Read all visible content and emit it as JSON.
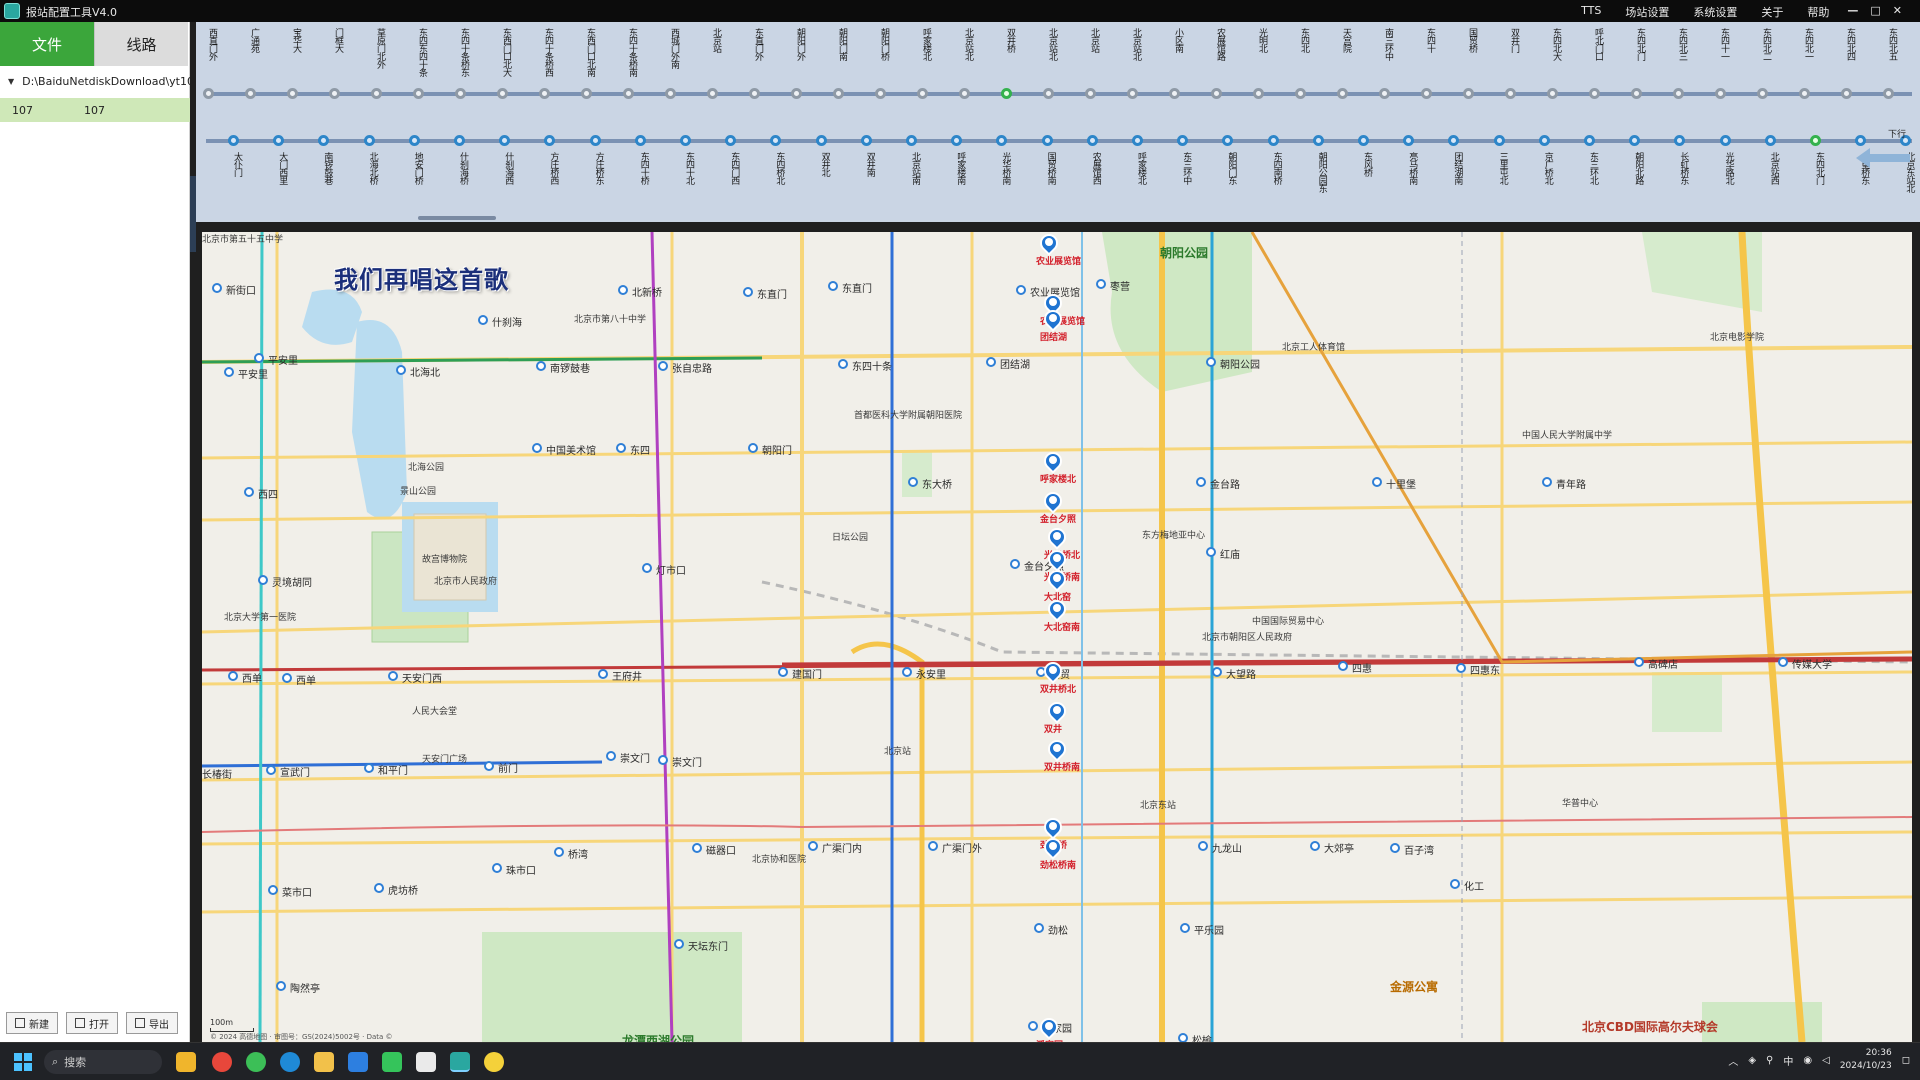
{
  "window": {
    "title": "报站配置工具V4.0",
    "menu": [
      "TTS",
      "场站设置",
      "系统设置",
      "关于",
      "帮助"
    ],
    "controls": [
      "—",
      "□",
      "✕"
    ]
  },
  "left_panel": {
    "tabs": {
      "file": "文件",
      "route": "线路"
    },
    "tree_path": "D:\\BaiduNetdiskDownload\\yt10",
    "route_row": {
      "col1": "107",
      "col2": "107"
    },
    "buttons": {
      "new": "新建",
      "open": "打开",
      "export": "导出"
    }
  },
  "diagram": {
    "down_label": "下行",
    "up_stations": [
      "西直门外",
      "广通苑",
      "宝华大",
      "门框大",
      "草原门北外",
      "东四东四十条",
      "东四十条桥东",
      "东西门口北大",
      "东四十条桥西",
      "东西门口北南",
      "东四十条桥南",
      "西城门外南",
      "北京站",
      "东直门外",
      "朝阳门外",
      "朝阳门南",
      "朝阳门桥",
      "呼家楼北",
      "北京站北",
      "双井桥",
      "北京站北",
      "北京站",
      "北京站北",
      "小区南",
      "农展馆路",
      "光明北",
      "东四北",
      "天宫院",
      "南三环中",
      "东四十",
      "国贸桥",
      "双井门",
      "东四北大",
      "呼北门口",
      "东四北门",
      "东四北三",
      "东四十一",
      "东四北二",
      "东四北一",
      "东四北四",
      "东四北五"
    ],
    "down_stations": [
      "太仆门",
      "大门西里",
      "南锣鼓巷",
      "北海北桥",
      "地安门桥",
      "什刹海桥",
      "什刹海西",
      "方庄桥西",
      "方庄桥东",
      "东四十桥",
      "东四十北",
      "东四门西",
      "东四桥北",
      "双井北",
      "双井南",
      "北京站南",
      "呼家楼南",
      "光华桥南",
      "国贸桥南",
      "农展馆西",
      "呼家楼北",
      "东三环中",
      "朝阳门东",
      "东四南桥",
      "朝阳公园东",
      "东风桥",
      "亮马桥南",
      "团结湖南",
      "三里屯北",
      "京广桥北",
      "东三环北",
      "朝阳北路",
      "长虹桥东",
      "光华路北",
      "北京站西",
      "东四北门",
      "大望桥东",
      "北京东站北"
    ],
    "active_up_index": 19,
    "active_down_index": 35
  },
  "map": {
    "overlay_lyric": "我们再唱这首歌",
    "labels": [
      {
        "t": "新街口",
        "c": "m"
      },
      {
        "t": "北新桥",
        "c": "m"
      },
      {
        "t": "东直门",
        "c": "m"
      },
      {
        "t": "东直门",
        "c": "m"
      },
      {
        "t": "农业展览馆",
        "c": "m"
      },
      {
        "t": "枣营",
        "c": "m"
      },
      {
        "t": "朝阳公园",
        "c": "big"
      },
      {
        "t": "什刹海",
        "c": "m"
      },
      {
        "t": "平安里",
        "c": "m"
      },
      {
        "t": "平安里",
        "c": "m"
      },
      {
        "t": "北海北",
        "c": "m"
      },
      {
        "t": "南锣鼓巷",
        "c": "m"
      },
      {
        "t": "张自忠路",
        "c": "m"
      },
      {
        "t": "东四十条",
        "c": "m"
      },
      {
        "t": "团结湖",
        "c": "m"
      },
      {
        "t": "朝阳公园",
        "c": "m"
      },
      {
        "t": "中国美术馆",
        "c": "m"
      },
      {
        "t": "东四",
        "c": "m"
      },
      {
        "t": "朝阳门",
        "c": "m"
      },
      {
        "t": "东大桥",
        "c": "m"
      },
      {
        "t": "金台路",
        "c": "m"
      },
      {
        "t": "十里堡",
        "c": "m"
      },
      {
        "t": "青年路",
        "c": "m"
      },
      {
        "t": "西四",
        "c": "m"
      },
      {
        "t": "灯市口",
        "c": "m"
      },
      {
        "t": "金台夕照",
        "c": "m"
      },
      {
        "t": "红庙",
        "c": "m"
      },
      {
        "t": "灵境胡同",
        "c": "m"
      },
      {
        "t": "西单",
        "c": "m"
      },
      {
        "t": "西单",
        "c": "m"
      },
      {
        "t": "天安门西",
        "c": "m"
      },
      {
        "t": "王府井",
        "c": "m"
      },
      {
        "t": "建国门",
        "c": "m"
      },
      {
        "t": "永安里",
        "c": "m"
      },
      {
        "t": "国贸",
        "c": "m"
      },
      {
        "t": "大望路",
        "c": "m"
      },
      {
        "t": "四惠",
        "c": "m"
      },
      {
        "t": "四惠东",
        "c": "m"
      },
      {
        "t": "高碑店",
        "c": "m"
      },
      {
        "t": "传媒大学",
        "c": "m"
      },
      {
        "t": "长椿街",
        "c": "m"
      },
      {
        "t": "宣武门",
        "c": "m"
      },
      {
        "t": "和平门",
        "c": "m"
      },
      {
        "t": "前门",
        "c": "m"
      },
      {
        "t": "崇文门",
        "c": "m"
      },
      {
        "t": "崇文门",
        "c": "m"
      },
      {
        "t": "磁器口",
        "c": "m"
      },
      {
        "t": "广渠门内",
        "c": "m"
      },
      {
        "t": "广渠门外",
        "c": "m"
      },
      {
        "t": "九龙山",
        "c": "m"
      },
      {
        "t": "大郊亭",
        "c": "m"
      },
      {
        "t": "百子湾",
        "c": "m"
      },
      {
        "t": "化工",
        "c": "m"
      },
      {
        "t": "菜市口",
        "c": "m"
      },
      {
        "t": "虎坊桥",
        "c": "m"
      },
      {
        "t": "珠市口",
        "c": "m"
      },
      {
        "t": "桥湾",
        "c": "m"
      },
      {
        "t": "天坛东门",
        "c": "m"
      },
      {
        "t": "劲松",
        "c": "m"
      },
      {
        "t": "平乐园",
        "c": "m"
      },
      {
        "t": "陶然亭",
        "c": "m"
      },
      {
        "t": "潘家园",
        "c": "m"
      },
      {
        "t": "松榆",
        "c": "m"
      },
      {
        "t": "金源公寓",
        "c": "orange"
      },
      {
        "t": "北京CBD国际高尔夫球会",
        "c": "red"
      },
      {
        "t": "龙潭西湖公园",
        "c": "big"
      },
      {
        "t": "故宫博物院",
        "c": ""
      },
      {
        "t": "北京站",
        "c": ""
      },
      {
        "t": "北京东站",
        "c": ""
      },
      {
        "t": "日坛公园",
        "c": ""
      },
      {
        "t": "中国国际贸易中心",
        "c": ""
      },
      {
        "t": "北京协和医院",
        "c": ""
      },
      {
        "t": "北京大学第一医院",
        "c": ""
      },
      {
        "t": "北海公园",
        "c": ""
      },
      {
        "t": "景山公园",
        "c": ""
      },
      {
        "t": "人民大会堂",
        "c": ""
      },
      {
        "t": "天安门广场",
        "c": ""
      },
      {
        "t": "北京市人民政府",
        "c": ""
      },
      {
        "t": "中国人民大学附属中学",
        "c": ""
      },
      {
        "t": "北京工人体育馆",
        "c": ""
      },
      {
        "t": "东方梅地亚中心",
        "c": ""
      },
      {
        "t": "首都医科大学附属朝阳医院",
        "c": ""
      },
      {
        "t": "北京市朝阳区人民政府",
        "c": ""
      },
      {
        "t": "华普中心",
        "c": ""
      },
      {
        "t": "北京电影学院",
        "c": ""
      },
      {
        "t": "北京市第八十中学",
        "c": ""
      },
      {
        "t": "北京市第五十五中学",
        "c": ""
      }
    ],
    "pins": [
      "农业展览馆",
      "农业展览馆",
      "团结湖",
      "呼家楼北",
      "金台夕照",
      "光华桥北",
      "光华桥南",
      "大北窑",
      "大北窑南",
      "双井桥北",
      "双井",
      "双井桥南",
      "劲松桥",
      "劲松桥南",
      "潘家园"
    ],
    "scale": "100m",
    "copyright": "© 2024 高德地图 · 审图号：GS(2024)5002号 · Data ©"
  },
  "taskbar": {
    "search_placeholder": "搜索",
    "tray": {
      "ime": "中",
      "time": "20:36",
      "date": "2024/10/23"
    }
  }
}
